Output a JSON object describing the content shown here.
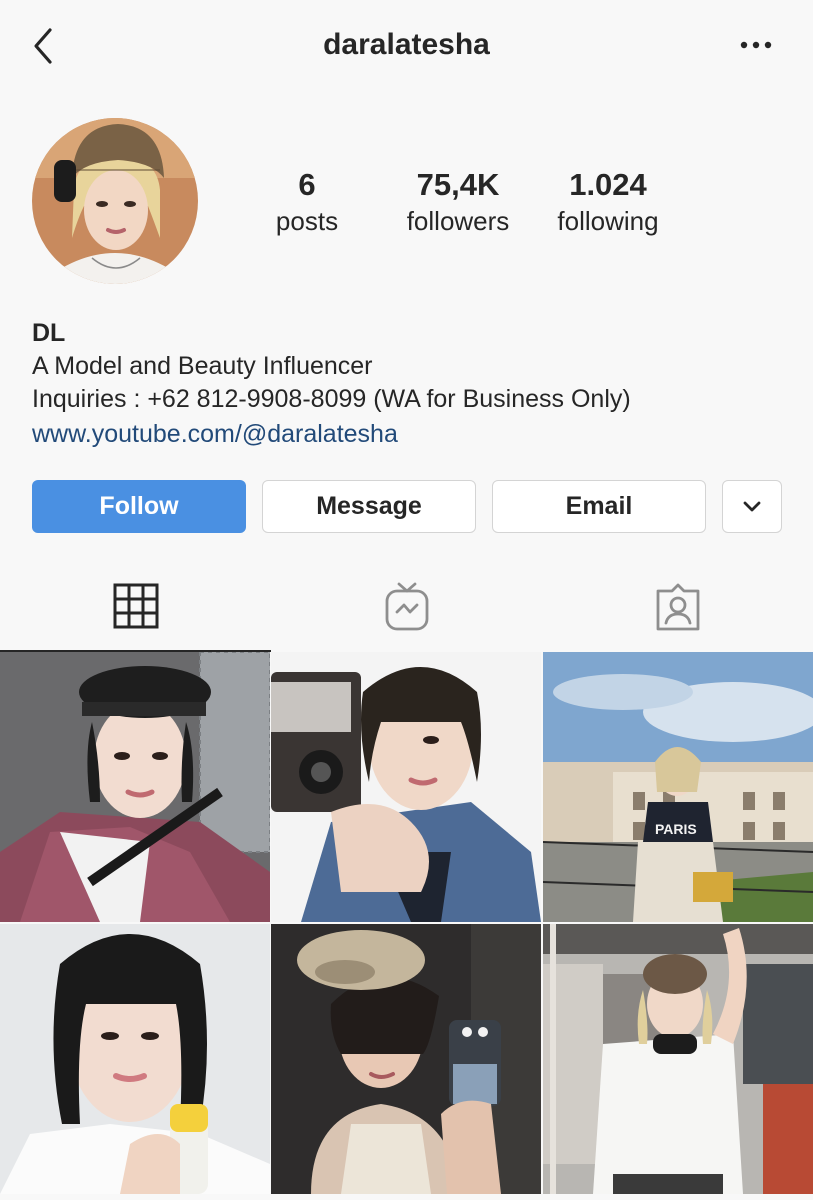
{
  "header": {
    "username": "daralatesha",
    "back_icon": "chevron-left-icon",
    "more_icon": "ellipsis-icon"
  },
  "profile": {
    "stats": [
      {
        "value": "6",
        "label": "posts"
      },
      {
        "value": "75,4K",
        "label": "followers"
      },
      {
        "value": "1.024",
        "label": "following"
      }
    ]
  },
  "bio": {
    "name": "DL",
    "lines": [
      "A Model and Beauty Influencer",
      "Inquiries : +62 812-9908-8099 (WA for Business Only)"
    ],
    "link": "www.youtube.com/@daralatesha"
  },
  "actions": {
    "follow": "Follow",
    "message": "Message",
    "email": "Email",
    "more_icon": "chevron-down-icon"
  },
  "tabs": [
    {
      "icon": "grid-icon",
      "active": true
    },
    {
      "icon": "igtv-icon",
      "active": false
    },
    {
      "icon": "tagged-icon",
      "active": false
    }
  ],
  "colors": {
    "accent": "#4a90e2",
    "link": "#224a79",
    "text": "#262626",
    "background": "#f8f8f8"
  }
}
